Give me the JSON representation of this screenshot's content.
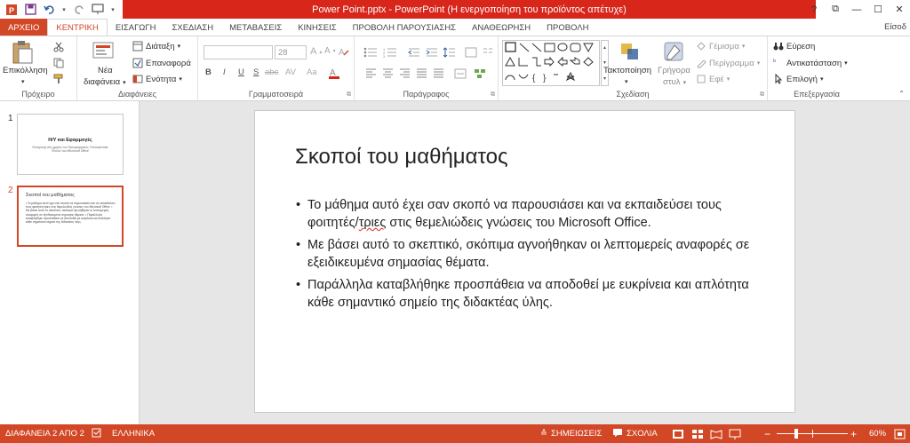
{
  "window": {
    "title": "Power Point.pptx - PowerPoint (Η ενεργοποίηση του προϊόντος απέτυχε)",
    "controls": [
      "?",
      "⧉",
      "—",
      "☐",
      "✕"
    ]
  },
  "tabs": [
    {
      "label": "ΑΡΧΕΙΟ"
    },
    {
      "label": "ΚΕΝΤΡΙΚΗ"
    },
    {
      "label": "ΕΙΣΑΓΩΓΗ"
    },
    {
      "label": "ΣΧΕΔΙΑΣΗ"
    },
    {
      "label": "ΜΕΤΑΒΑΣΕΙΣ"
    },
    {
      "label": "ΚΙΝΗΣΕΙΣ"
    },
    {
      "label": "ΠΡΟΒΟΛΗ ΠΑΡΟΥΣΙΑΣΗΣ"
    },
    {
      "label": "ΑΝΑΘΕΩΡΗΣΗ"
    },
    {
      "label": "ΠΡΟΒΟΛΗ"
    }
  ],
  "signin": "Είσοδ",
  "ribbon": {
    "clipboard": {
      "paste": "Επικόλληση",
      "label": "Πρόχειρο"
    },
    "slides": {
      "new_slide_1": "Νέα",
      "new_slide_2": "διαφάνεια",
      "layout": "Διάταξη",
      "reset": "Επαναφορά",
      "section": "Ενότητα",
      "label": "Διαφάνειες"
    },
    "font": {
      "size": "28",
      "bold": "B",
      "italic": "I",
      "underline": "U",
      "strike": "S",
      "shadow": "abc",
      "spacing": "AV",
      "case": "Aa",
      "label": "Γραμματοσειρά"
    },
    "paragraph": {
      "label": "Παράγραφος"
    },
    "drawing": {
      "arrange": "Τακτοποίηση",
      "quick_styles_1": "Γρήγορα",
      "quick_styles_2": "στυλ",
      "fill": "Γέμισμα",
      "outline": "Περίγραμμα",
      "effects": "Εφέ",
      "label": "Σχεδίαση"
    },
    "editing": {
      "find": "Εύρεση",
      "replace": "Αντικατάσταση",
      "select": "Επιλογή",
      "label": "Επεξεργασία"
    }
  },
  "thumbnails": [
    {
      "num": "1",
      "title": "Η/Υ και Εφαρμογές",
      "sub": "Εισαγωγή στη χρήση του Προγράμματος Υπολογιστικά Φύλλα του Microsoft Office"
    },
    {
      "num": "2",
      "title": "Σκοποί του μαθήματος",
      "body": "• Το μάθημα αυτό έχει σαν σκοπό να παρουσιάσει και να εκπαιδεύσει τους φοιτητές/τριες στις θεμελιώδεις γνώσεις του Microsoft Office. • Με βάσει αυτό το σκεπτικό, σκόπιμα αγνοήθηκαν οι λεπτομερείς αναφορές σε εξειδικευμένα σημασίας θέματα. • Παράλληλα καταβλήθηκε προσπάθεια να αποδοθεί με ευκρίνεια και απλότητα κάθε σημαντικό σημείο της διδακτέας ύλης."
    }
  ],
  "slide": {
    "title": "Σκοποί του μαθήματος",
    "bullets": [
      {
        "pre": "Το μάθημα αυτό έχει σαν σκοπό να παρουσιάσει και να εκπαιδεύσει τους φοιτητές/",
        "mark": "τριες",
        "post": " στις θεμελιώδεις γνώσεις του Microsoft Office."
      },
      {
        "pre": "Με βάσει αυτό το σκεπτικό, σκόπιμα αγνοήθηκαν οι λεπτομερείς αναφορές σε εξειδικευμένα σημασίας θέματα.",
        "mark": "",
        "post": ""
      },
      {
        "pre": "Παράλληλα καταβλήθηκε προσπάθεια να αποδοθεί με ευκρίνεια και απλότητα κάθε σημαντικό σημείο της διδακτέας ύλης.",
        "mark": "",
        "post": ""
      }
    ]
  },
  "status": {
    "slide_count": "ΔΙΑΦΑΝΕΙΑ 2 ΑΠΟ 2",
    "language": "ΕΛΛΗΝΙΚΑ",
    "notes": "ΣΗΜΕΙΩΣΕΙΣ",
    "comments": "ΣΧΟΛΙΑ",
    "zoom": "60%",
    "zoom_level": 0.6
  },
  "colors": {
    "accent": "#d24726",
    "title_bar": "#d8261b"
  }
}
